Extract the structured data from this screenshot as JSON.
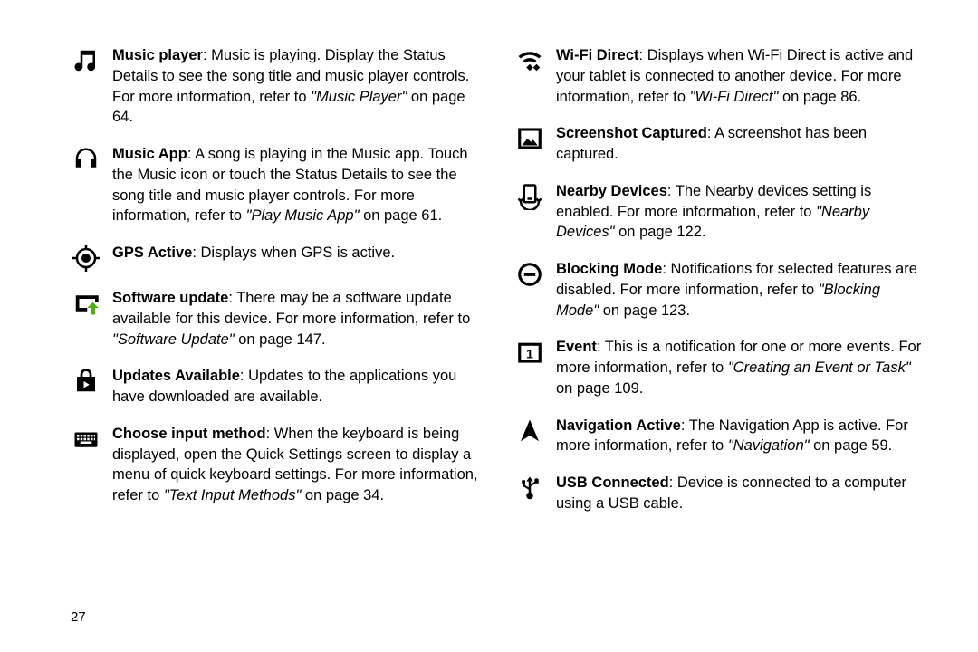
{
  "page_number": "27",
  "left": [
    {
      "title": "Music player",
      "body": ": Music is playing. Display the Status Details to see the song title and music player controls. For more information, refer to ",
      "ref": "\"Music Player\"",
      "tail": " on page 64."
    },
    {
      "title": "Music App",
      "body": ": A song is playing in the Music app. Touch the Music icon or touch the Status Details to see the song title and music player controls. For more information, refer to ",
      "ref": "\"Play Music App\"",
      "tail": " on page 61."
    },
    {
      "title": "GPS Active",
      "body": ": Displays when GPS is active.",
      "ref": "",
      "tail": ""
    },
    {
      "title": "Software update",
      "body": ": There may be a software update available for this device. For more information, refer to ",
      "ref": "\"Software Update\"",
      "tail": " on page 147."
    },
    {
      "title": "Updates Available",
      "body": ": Updates to the applications you have downloaded are available.",
      "ref": "",
      "tail": ""
    },
    {
      "title": "Choose input method",
      "body": ": When the keyboard is being displayed, open the Quick Settings screen to display a menu of quick keyboard settings. For more information, refer to ",
      "ref": "\"Text Input Methods\"",
      "tail": " on page 34."
    }
  ],
  "right": [
    {
      "title": "Wi-Fi Direct",
      "body": ": Displays when Wi-Fi Direct is active and your tablet is connected to another device. For more information, refer to ",
      "ref": "\"Wi-Fi Direct\"",
      "tail": " on page 86."
    },
    {
      "title": "Screenshot Captured",
      "body": ": A screenshot has been captured.",
      "ref": "",
      "tail": ""
    },
    {
      "title": "Nearby Devices",
      "body": ": The Nearby devices setting is enabled. For more information, refer to ",
      "ref": "\"Nearby Devices\"",
      "tail": " on page 122."
    },
    {
      "title": "Blocking Mode",
      "body": ": Notifications for selected features are disabled. For more information, refer to ",
      "ref": "\"Blocking Mode\"",
      "tail": " on page 123."
    },
    {
      "title": "Event",
      "body": ": This is a notification for one or more events. For more information, refer to ",
      "ref": "\"Creating an Event or Task\"",
      "tail": " on page 109."
    },
    {
      "title": "Navigation Active",
      "body": ": The Navigation App is active. For more information, refer to ",
      "ref": "\"Navigation\"",
      "tail": " on page 59."
    },
    {
      "title": "USB Connected",
      "body": ": Device is connected to a computer using a USB cable.",
      "ref": "",
      "tail": ""
    }
  ]
}
